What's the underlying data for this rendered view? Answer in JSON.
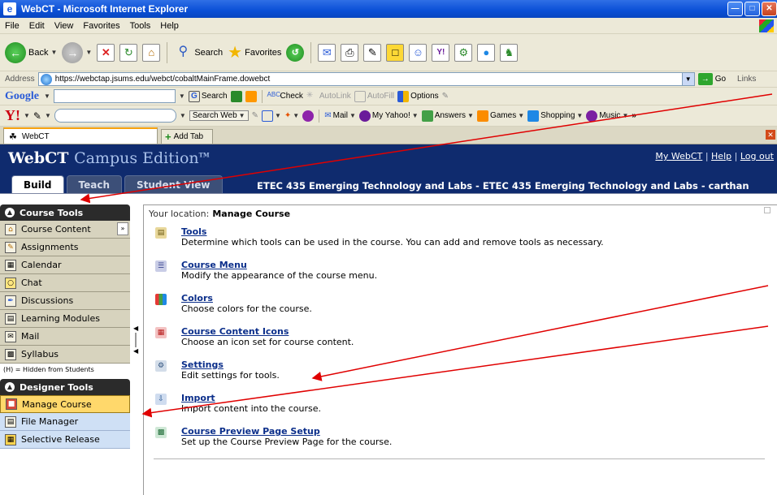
{
  "browser": {
    "window_title": "WebCT - Microsoft Internet Explorer",
    "menu": [
      "File",
      "Edit",
      "View",
      "Favorites",
      "Tools",
      "Help"
    ],
    "toolbar": {
      "back_label": "Back",
      "search_label": "Search",
      "favorites_label": "Favorites"
    },
    "address": {
      "label": "Address",
      "url": "https://webctap.jsums.edu/webct/cobaltMainFrame.dowebct",
      "go_label": "Go",
      "links_label": "Links"
    },
    "google_bar": {
      "logo": "Google",
      "search_label": "Search",
      "check_label": "Check",
      "autolink_label": "AutoLink",
      "autofill_label": "AutoFill",
      "options_label": "Options"
    },
    "yahoo_bar": {
      "logo": "Y!",
      "search_web_label": "Search Web",
      "items": [
        "Mail",
        "My Yahoo!",
        "Answers",
        "Games",
        "Shopping",
        "Music"
      ]
    },
    "tabs": {
      "active_tab": "WebCT",
      "add_tab_label": "Add Tab"
    }
  },
  "webct": {
    "logo_main": "WebCT",
    "logo_sub": "Campus Edition",
    "logo_tm": "TM",
    "links": {
      "my_webct": "My WebCT",
      "help": "Help",
      "log_out": "Log out",
      "separator": "|"
    },
    "tabs": [
      {
        "label": "Build",
        "active": true
      },
      {
        "label": "Teach",
        "active": false
      },
      {
        "label": "Student View",
        "active": false
      }
    ],
    "course_title": "ETEC 435 Emerging Technology and Labs - ETEC 435 Emerging Technology and Labs - carthan"
  },
  "sidebar": {
    "course_tools_title": "Course Tools",
    "course_tools": [
      {
        "label": "Course Content"
      },
      {
        "label": "Assignments"
      },
      {
        "label": "Calendar"
      },
      {
        "label": "Chat"
      },
      {
        "label": "Discussions"
      },
      {
        "label": "Learning Modules"
      },
      {
        "label": "Mail"
      },
      {
        "label": "Syllabus"
      }
    ],
    "hidden_note": "(H) = Hidden from Students",
    "designer_tools_title": "Designer Tools",
    "designer_tools": [
      {
        "label": "Manage Course",
        "selected": true
      },
      {
        "label": "File Manager",
        "selected": false
      },
      {
        "label": "Selective Release",
        "selected": false
      }
    ]
  },
  "main": {
    "location_prefix": "Your location:",
    "location_value": "Manage Course",
    "entries": [
      {
        "title": "Tools",
        "desc": "Determine which tools can be used in the course. You can add and remove tools as necessary.",
        "color": "#c8a64b"
      },
      {
        "title": "Course Menu",
        "desc": "Modify the appearance of the course menu.",
        "color": "#7a86b8"
      },
      {
        "title": "Colors",
        "desc": "Choose colors for the course.",
        "color": "#d0352a"
      },
      {
        "title": "Course Content Icons",
        "desc": "Choose an icon set for course content.",
        "color": "#d94b4b"
      },
      {
        "title": "Settings",
        "desc": "Edit settings for tools.",
        "color": "#6c8fb7"
      },
      {
        "title": "Import",
        "desc": "Import content into the course.",
        "color": "#4f79b5"
      },
      {
        "title": "Course Preview Page Setup",
        "desc": "Set up the Course Preview Page for the course.",
        "color": "#3f9a5a"
      }
    ]
  },
  "annotation_color": "#e00000"
}
